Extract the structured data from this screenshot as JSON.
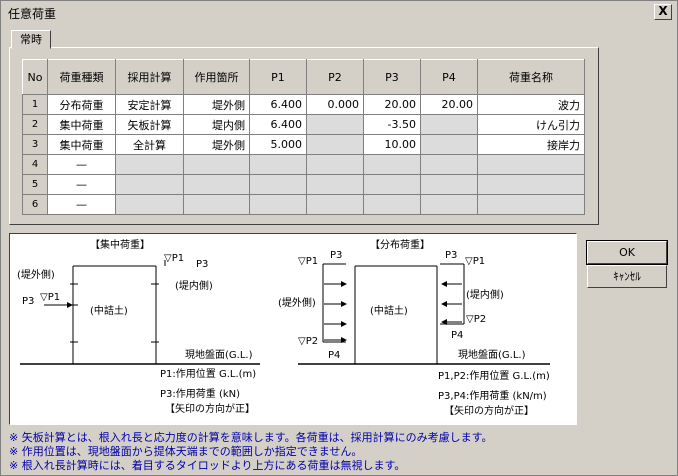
{
  "window": {
    "title": "任意荷重",
    "close": "X"
  },
  "tab": {
    "label": "常時"
  },
  "table": {
    "headers": [
      "No",
      "荷重種類",
      "採用計算",
      "作用箇所",
      "P1",
      "P2",
      "P3",
      "P4",
      "荷重名称"
    ],
    "rows": [
      [
        "1",
        "分布荷重",
        "安定計算",
        "堤外側",
        "6.400",
        "0.000",
        "20.00",
        "20.00",
        "波力"
      ],
      [
        "2",
        "集中荷重",
        "矢板計算",
        "堤内側",
        "6.400",
        "",
        "-3.50",
        "",
        "けん引力"
      ],
      [
        "3",
        "集中荷重",
        "全計算",
        "堤外側",
        "5.000",
        "",
        "10.00",
        "",
        "接岸力"
      ],
      [
        "4",
        "—",
        "",
        "",
        "",
        "",
        "",
        "",
        ""
      ],
      [
        "5",
        "—",
        "",
        "",
        "",
        "",
        "",
        "",
        ""
      ],
      [
        "6",
        "—",
        "",
        "",
        "",
        "",
        "",
        "",
        ""
      ]
    ]
  },
  "figure": {
    "left": {
      "title": "【集中荷重】",
      "p1": "▽P1",
      "p3top": "P3",
      "outer": "(堤外側)",
      "inner": "(堤内側)",
      "p3left": "P3",
      "p1left": "▽P1",
      "soil": "(中詰土)",
      "ground": "現地盤面(G.L.)",
      "legend1": "P1:作用位置 G.L.(m)",
      "legend2": "P3:作用荷重 (kN)",
      "legend3": "【矢印の方向が正】"
    },
    "right": {
      "title": "【分布荷重】",
      "p1l": "▽P1",
      "p3l": "P3",
      "p3r": "P3",
      "p1r": "▽P1",
      "outer": "(堤外側)",
      "inner": "(堤内側)",
      "soil": "(中詰土)",
      "p2l": "▽P2",
      "p4l": "P4",
      "p4r": "P4",
      "p2r": "▽P2",
      "ground": "現地盤面(G.L.)",
      "legend1": "P1,P2:作用位置 G.L.(m)",
      "legend2": "P3,P4:作用荷重 (kN/m)",
      "legend3": "【矢印の方向が正】"
    }
  },
  "buttons": {
    "ok": "OK",
    "cancel": "ｷｬﾝｾﾙ"
  },
  "notes": [
    "※ 矢板計算とは、根入れ長と応力度の計算を意味します。各荷重は、採用計算にのみ考慮します。",
    "※ 作用位置は、現地盤面から提体天端までの範囲しか指定できません。",
    "※ 根入れ長計算時には、着目するタイロッドより上方にある荷重は無視します。"
  ]
}
